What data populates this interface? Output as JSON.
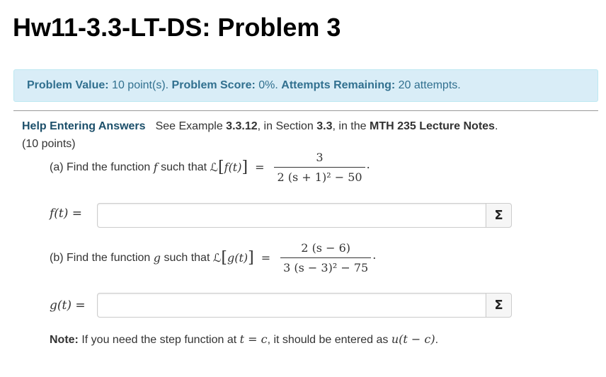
{
  "page": {
    "title": "Hw11-3.3-LT-DS: Problem 3"
  },
  "info": {
    "value_label": "Problem Value:",
    "value_text": "10 point(s).",
    "score_label": "Problem Score:",
    "score_text": "0%.",
    "attempts_label": "Attempts Remaining:",
    "attempts_text": "20 attempts."
  },
  "help": {
    "link": "Help Entering Answers",
    "see": "See Example ",
    "example_num": "3.3.12",
    "in_section": ", in Section ",
    "section_num": "3.3",
    "in_the": ", in the ",
    "notes": "MTH 235 Lecture Notes",
    "period": "."
  },
  "points": "(10 points)",
  "part_a": {
    "prompt": "(a) Find the function ",
    "var": "f",
    "such_that": " such that ",
    "lhs": "f(t)",
    "numerator": "3",
    "denominator": "2 (s + 1)² − 50",
    "answer_label": "f(t) =",
    "answer_value": ""
  },
  "part_b": {
    "prompt": "(b) Find the function ",
    "var": "g",
    "such_that": " such that ",
    "lhs": "g(t)",
    "numerator": "2 (s − 6)",
    "denominator": "3 (s − 3)² − 75",
    "answer_label": "g(t) =",
    "answer_value": ""
  },
  "sigma_label": "Σ",
  "laplace_symbol": "ℒ",
  "note": {
    "label": "Note:",
    "text1": " If you need the step function at ",
    "cond": "t = c",
    "text2": ", it should be entered as ",
    "expr": "u(t − c)",
    "end": "."
  },
  "colors": {
    "info_bg": "#d9edf7",
    "info_text": "#31708f",
    "link": "#1c4f6a"
  }
}
